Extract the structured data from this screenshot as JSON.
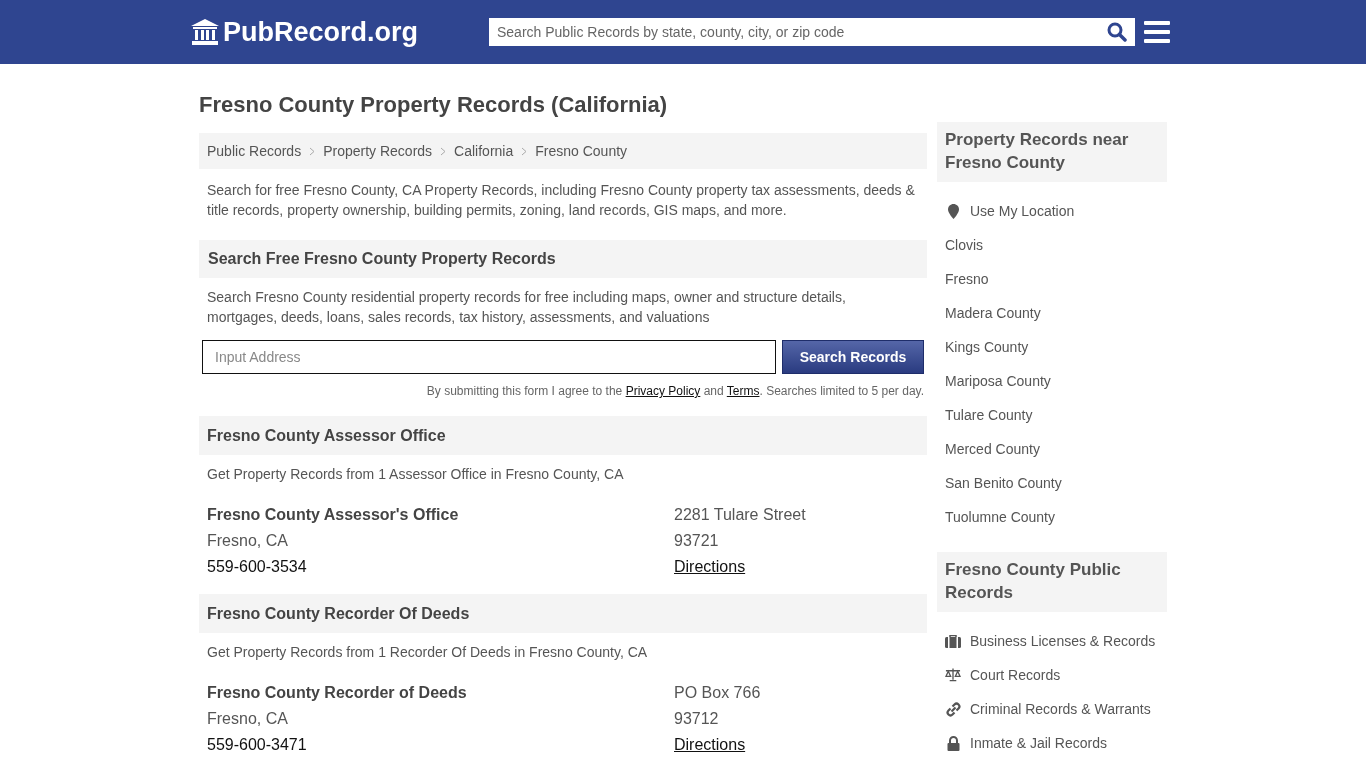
{
  "header": {
    "logo": "PubRecord.org",
    "search": {
      "placeholder": "Search Public Records by state, county, city, or zip code"
    }
  },
  "title": "Fresno County Property Records (California)",
  "breadcrumbs": [
    "Public Records",
    "Property Records",
    "California",
    "Fresno County"
  ],
  "intro": "Search for free Fresno County, CA Property Records, including Fresno County property tax assessments, deeds & title records, property ownership, building permits, zoning, land records, GIS maps, and more.",
  "search_section": {
    "heading": "Search Free Fresno County Property Records",
    "description": "Search Fresno County residential property records for free including maps, owner and structure details, mortgages, deeds, loans, sales records, tax history, assessments, and valuations",
    "address_field": {
      "placeholder": "Input Address"
    },
    "button": "Search Records",
    "disclaimer": [
      "By submitting this form I agree to the ",
      "Privacy Policy",
      " and ",
      "Terms",
      ". Searches limited to 5 per day."
    ]
  },
  "sections": [
    {
      "heading": "Fresno County Assessor Office",
      "description": "Get Property Records from 1 Assessor Office in Fresno County, CA",
      "offices": [
        {
          "name": "Fresno County Assessor's Office",
          "city": "Fresno, CA",
          "phone": "559-600-3534",
          "street": "2281 Tulare Street",
          "zip": "93721",
          "link": "Directions"
        }
      ]
    },
    {
      "heading": "Fresno County Recorder Of Deeds",
      "description": "Get Property Records from 1 Recorder Of Deeds in Fresno County, CA",
      "offices": [
        {
          "name": "Fresno County Recorder of Deeds",
          "city": "Fresno, CA",
          "phone": "559-600-3471",
          "street": "PO Box 766",
          "zip": "93712",
          "link": "Directions"
        }
      ]
    }
  ],
  "sidebar": [
    {
      "heading": "Property Records near Fresno County",
      "items": [
        {
          "label": "Use My Location",
          "kind": "location"
        },
        {
          "label": "Clovis"
        },
        {
          "label": "Fresno"
        },
        {
          "label": "Madera County"
        },
        {
          "label": "Kings County"
        },
        {
          "label": "Mariposa County"
        },
        {
          "label": "Tulare County"
        },
        {
          "label": "Merced County"
        },
        {
          "label": "San Benito County"
        },
        {
          "label": "Tuolumne County"
        }
      ]
    },
    {
      "heading": "Fresno County Public Records",
      "items": [
        {
          "label": "Business Licenses & Records",
          "kind": "briefcase"
        },
        {
          "label": "Court Records",
          "kind": "scale"
        },
        {
          "label": "Criminal Records & Warrants",
          "kind": "link"
        },
        {
          "label": "Inmate & Jail Records",
          "kind": "lock"
        }
      ]
    }
  ]
}
